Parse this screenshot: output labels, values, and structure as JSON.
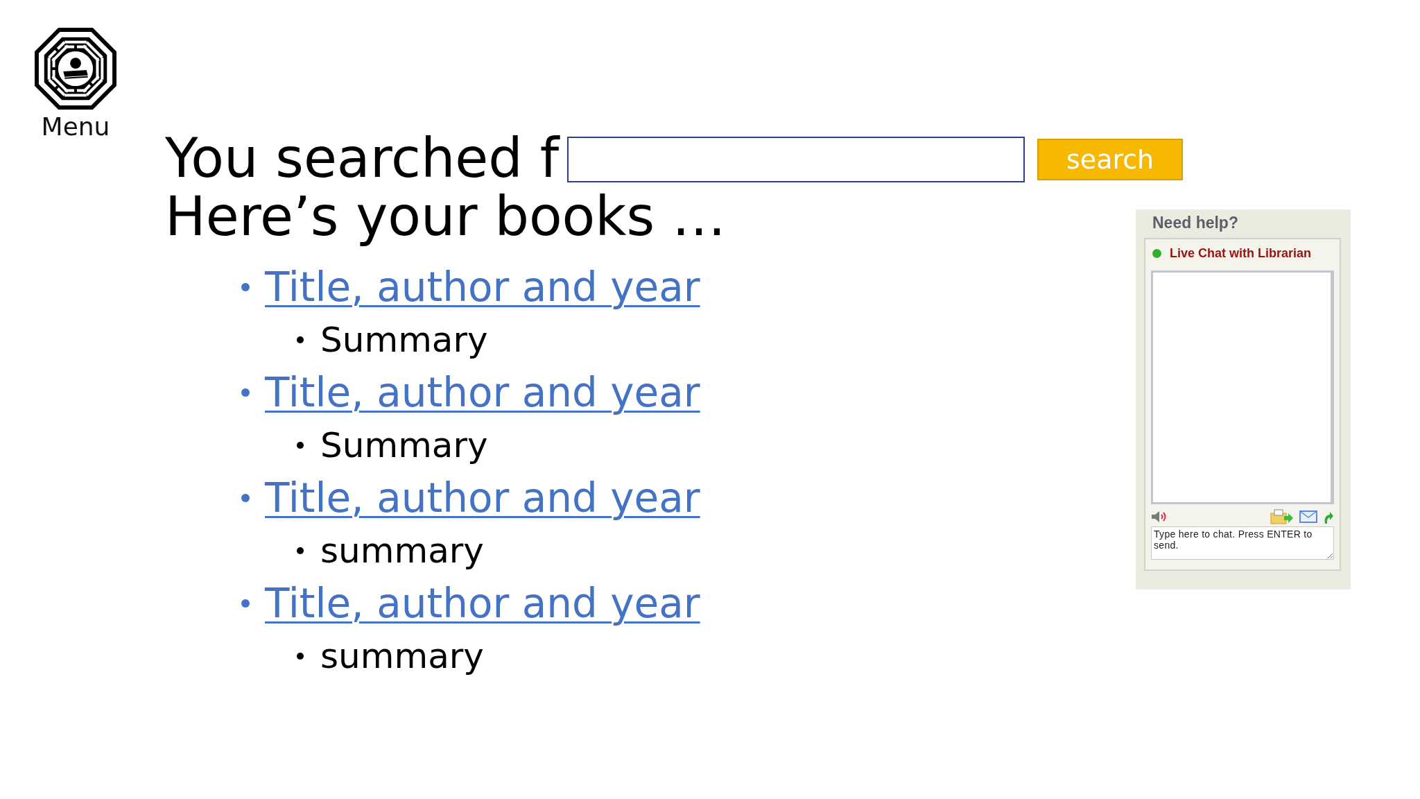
{
  "menu": {
    "label": "Menu"
  },
  "heading": {
    "line_1": "You searched f",
    "line_2": "Here’s your books …"
  },
  "search": {
    "button": "search"
  },
  "results": [
    {
      "title": "Title, author and year",
      "summary": "Summary"
    },
    {
      "title": "Title, author and year",
      "summary": "Summary"
    },
    {
      "title": "Title, author and year",
      "summary": "summary"
    },
    {
      "title": "Title, author and year",
      "summary": "summary"
    }
  ],
  "chat": {
    "title": "Need help?",
    "status": "Live Chat with Librarian",
    "online": true,
    "placeholder": "Type here to chat. Press ENTER to send."
  }
}
